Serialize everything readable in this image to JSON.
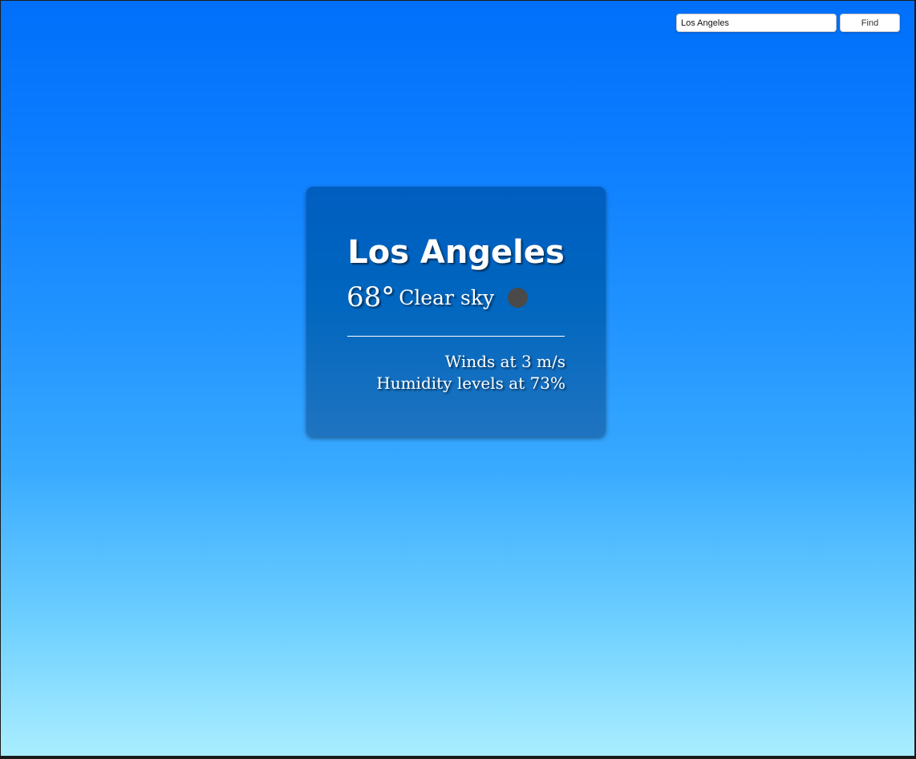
{
  "search": {
    "value": "Los Angeles",
    "button_label": "Find"
  },
  "weather": {
    "city": "Los Angeles",
    "temperature": "68°",
    "condition": "Clear sky",
    "condition_icon": "weather-condition-icon",
    "winds": "Winds at 3 m/s",
    "humidity": "Humidity levels at 73%"
  },
  "colors": {
    "background_top": "#006ffa",
    "background_bottom": "#aaeeff",
    "card": "#0066bf",
    "icon_dot": "#4a4a4a"
  }
}
